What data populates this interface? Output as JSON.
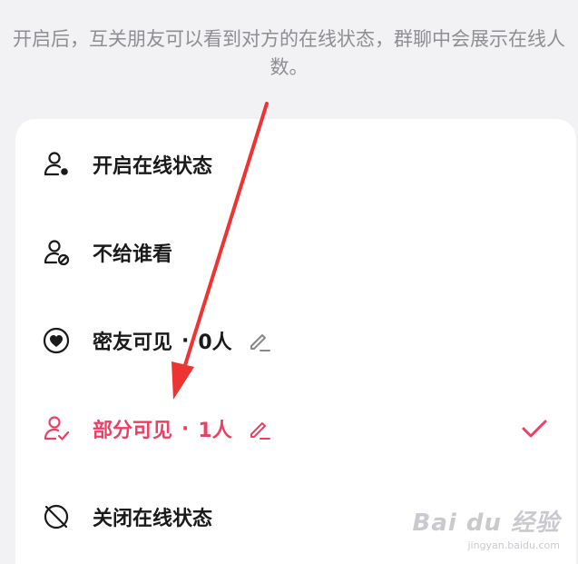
{
  "description": "开启后，互关朋友可以看到对方的在线状态，群聊中会展示在线人数。",
  "options": [
    {
      "label": "开启在线状态",
      "icon": "person-online-icon",
      "active": false
    },
    {
      "label": "不给谁看",
      "icon": "person-blocked-icon",
      "active": false
    },
    {
      "label": "密友可见",
      "count": "0人",
      "separator": "·",
      "icon": "heart-circle-icon",
      "active": false,
      "editable": true
    },
    {
      "label": "部分可见",
      "count": "1人",
      "separator": "·",
      "icon": "person-check-icon",
      "active": true,
      "editable": true
    },
    {
      "label": "关闭在线状态",
      "icon": "offline-circle-icon",
      "active": false
    }
  ],
  "accent_color": "#ee3f63",
  "watermark": {
    "logo": "Bai du 经验",
    "url": "jingyan.baidu.com"
  }
}
